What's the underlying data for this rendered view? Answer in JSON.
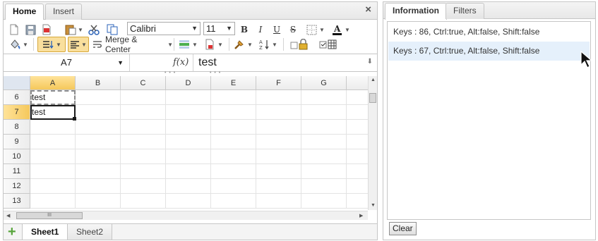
{
  "ribbon": {
    "tabs": [
      {
        "label": "Home",
        "active": true
      },
      {
        "label": "Insert",
        "active": false
      }
    ],
    "close_glyph": "×"
  },
  "toolbar": {
    "font_name": "Calibri",
    "font_size": "11",
    "bold": "B",
    "italic": "I",
    "underline": "U",
    "strikethrough": "S",
    "merge_label": "Merge & Center",
    "icons": [
      "new-document-icon",
      "save-icon",
      "pdf-icon",
      "paste-icon",
      "cut-icon",
      "copy-icon",
      "borders-icon",
      "font-color-icon",
      "fill-color-icon",
      "vertical-align-icon",
      "horizontal-align-icon",
      "wrap-text-icon",
      "insert-row-icon",
      "clear-icon",
      "format-painter-icon",
      "sort-icon",
      "lock-icon",
      "gridlines-icon"
    ],
    "accent": "#f5c85b"
  },
  "formula_bar": {
    "name_box": "A7",
    "fx_label": "f(x)",
    "value": "test"
  },
  "grid": {
    "columns": [
      "A",
      "B",
      "C",
      "D",
      "E",
      "F",
      "G"
    ],
    "selected_column": "A",
    "rows": [
      "6",
      "7",
      "8",
      "9",
      "10",
      "11",
      "12",
      "13"
    ],
    "selected_row": "7",
    "cells": {
      "A6": "test",
      "A7": "test"
    },
    "copied_cell": "A6",
    "active_cell": "A7",
    "hscroll_grip": "III"
  },
  "sheets": [
    {
      "label": "Sheet1",
      "active": true
    },
    {
      "label": "Sheet2",
      "active": false
    }
  ],
  "panel": {
    "tabs": [
      {
        "label": "Information",
        "active": true
      },
      {
        "label": "Filters",
        "active": false
      }
    ],
    "log": [
      "Keys : 86, Ctrl:true, Alt:false, Shift:false",
      "Keys : 67, Ctrl:true, Alt:false, Shift:false"
    ],
    "clear_label": "Clear"
  }
}
